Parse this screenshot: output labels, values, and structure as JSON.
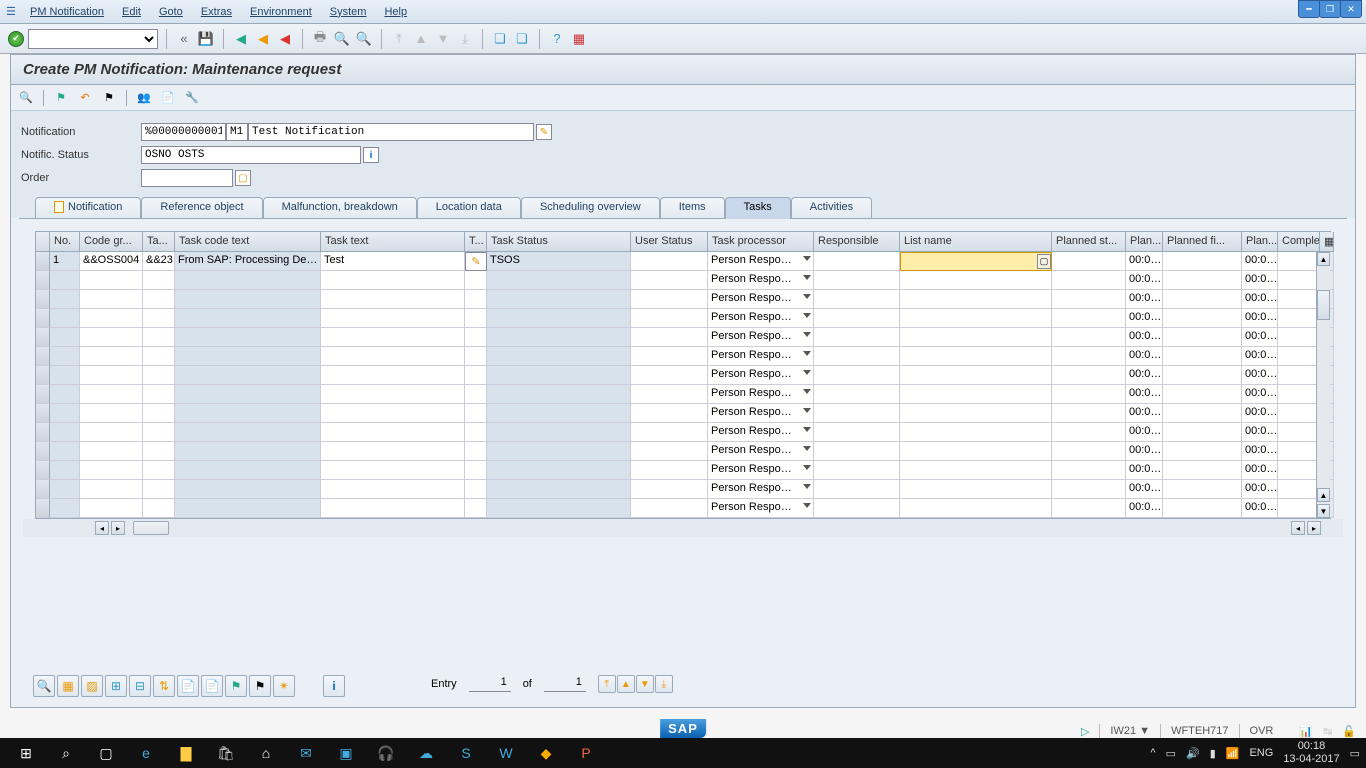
{
  "menu": {
    "items": [
      "PM Notification",
      "Edit",
      "Goto",
      "Extras",
      "Environment",
      "System",
      "Help"
    ]
  },
  "page": {
    "title": "Create PM Notification: Maintenance request"
  },
  "form": {
    "notification_label": "Notification",
    "notification_no": "%00000000001",
    "notification_type": "M1",
    "notification_text": "Test Notification",
    "status_label": "Notific. Status",
    "status_value": "OSNO OSTS",
    "order_label": "Order",
    "order_value": ""
  },
  "tabs": [
    "Notification",
    "Reference object",
    "Malfunction, breakdown",
    "Location data",
    "Scheduling overview",
    "Items",
    "Tasks",
    "Activities"
  ],
  "active_tab": 6,
  "table": {
    "headers": [
      "",
      "No.",
      "Code gr...",
      "Ta...",
      "Task code text",
      "Task text",
      "T...",
      "Task Status",
      "User Status",
      "Task processor",
      "Responsible",
      "List name",
      "Planned st...",
      "Plan...",
      "Planned fi...",
      "Plan...",
      "Comple",
      ""
    ],
    "row1": {
      "no": "1",
      "code_group": "&&OSS004",
      "ta": "&&23",
      "task_code_text": "From SAP: Processing De…",
      "task_text": "Test",
      "status": "TSOS",
      "processor": "Person Respo…",
      "plan1": "00:0…",
      "plan2": "00:0…"
    },
    "default_processor": "Person Respo…",
    "default_time": "00:0…",
    "row_count": 14
  },
  "entry": {
    "label": "Entry",
    "current": "1",
    "of": "of",
    "total": "1"
  },
  "status": {
    "tcode": "IW21",
    "server": "WFTEH717",
    "mode": "OVR"
  },
  "clock": {
    "time": "00:18",
    "date": "13-04-2017"
  },
  "lang": "ENG"
}
